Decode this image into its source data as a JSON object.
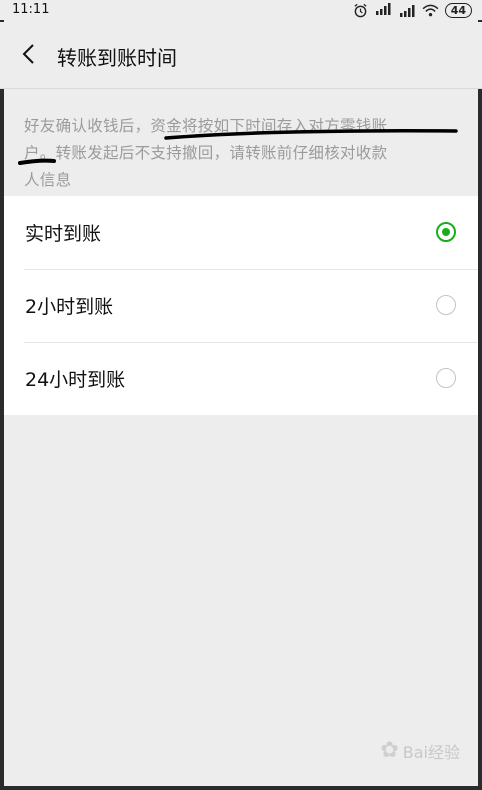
{
  "statusbar": {
    "time": "11:11",
    "alarm_icon": "alarm-icon",
    "signal_hd_label": "HD",
    "battery": "44"
  },
  "navbar": {
    "title": "转账到账时间"
  },
  "description": {
    "lines": [
      "好友确认收钱后，资金将按如下时间存入对方零钱账",
      "户。转账发起后不支持撤回，请转账前仔细核对收款",
      "人信息"
    ]
  },
  "options": [
    {
      "label": "实时到账",
      "selected": true
    },
    {
      "label": "2小时到账",
      "selected": false
    },
    {
      "label": "24小时到账",
      "selected": false
    }
  ],
  "watermark": {
    "text": "Bai经验"
  },
  "colors": {
    "accent": "#1aad19",
    "background": "#ededed",
    "description_text": "#9b9b9b"
  }
}
